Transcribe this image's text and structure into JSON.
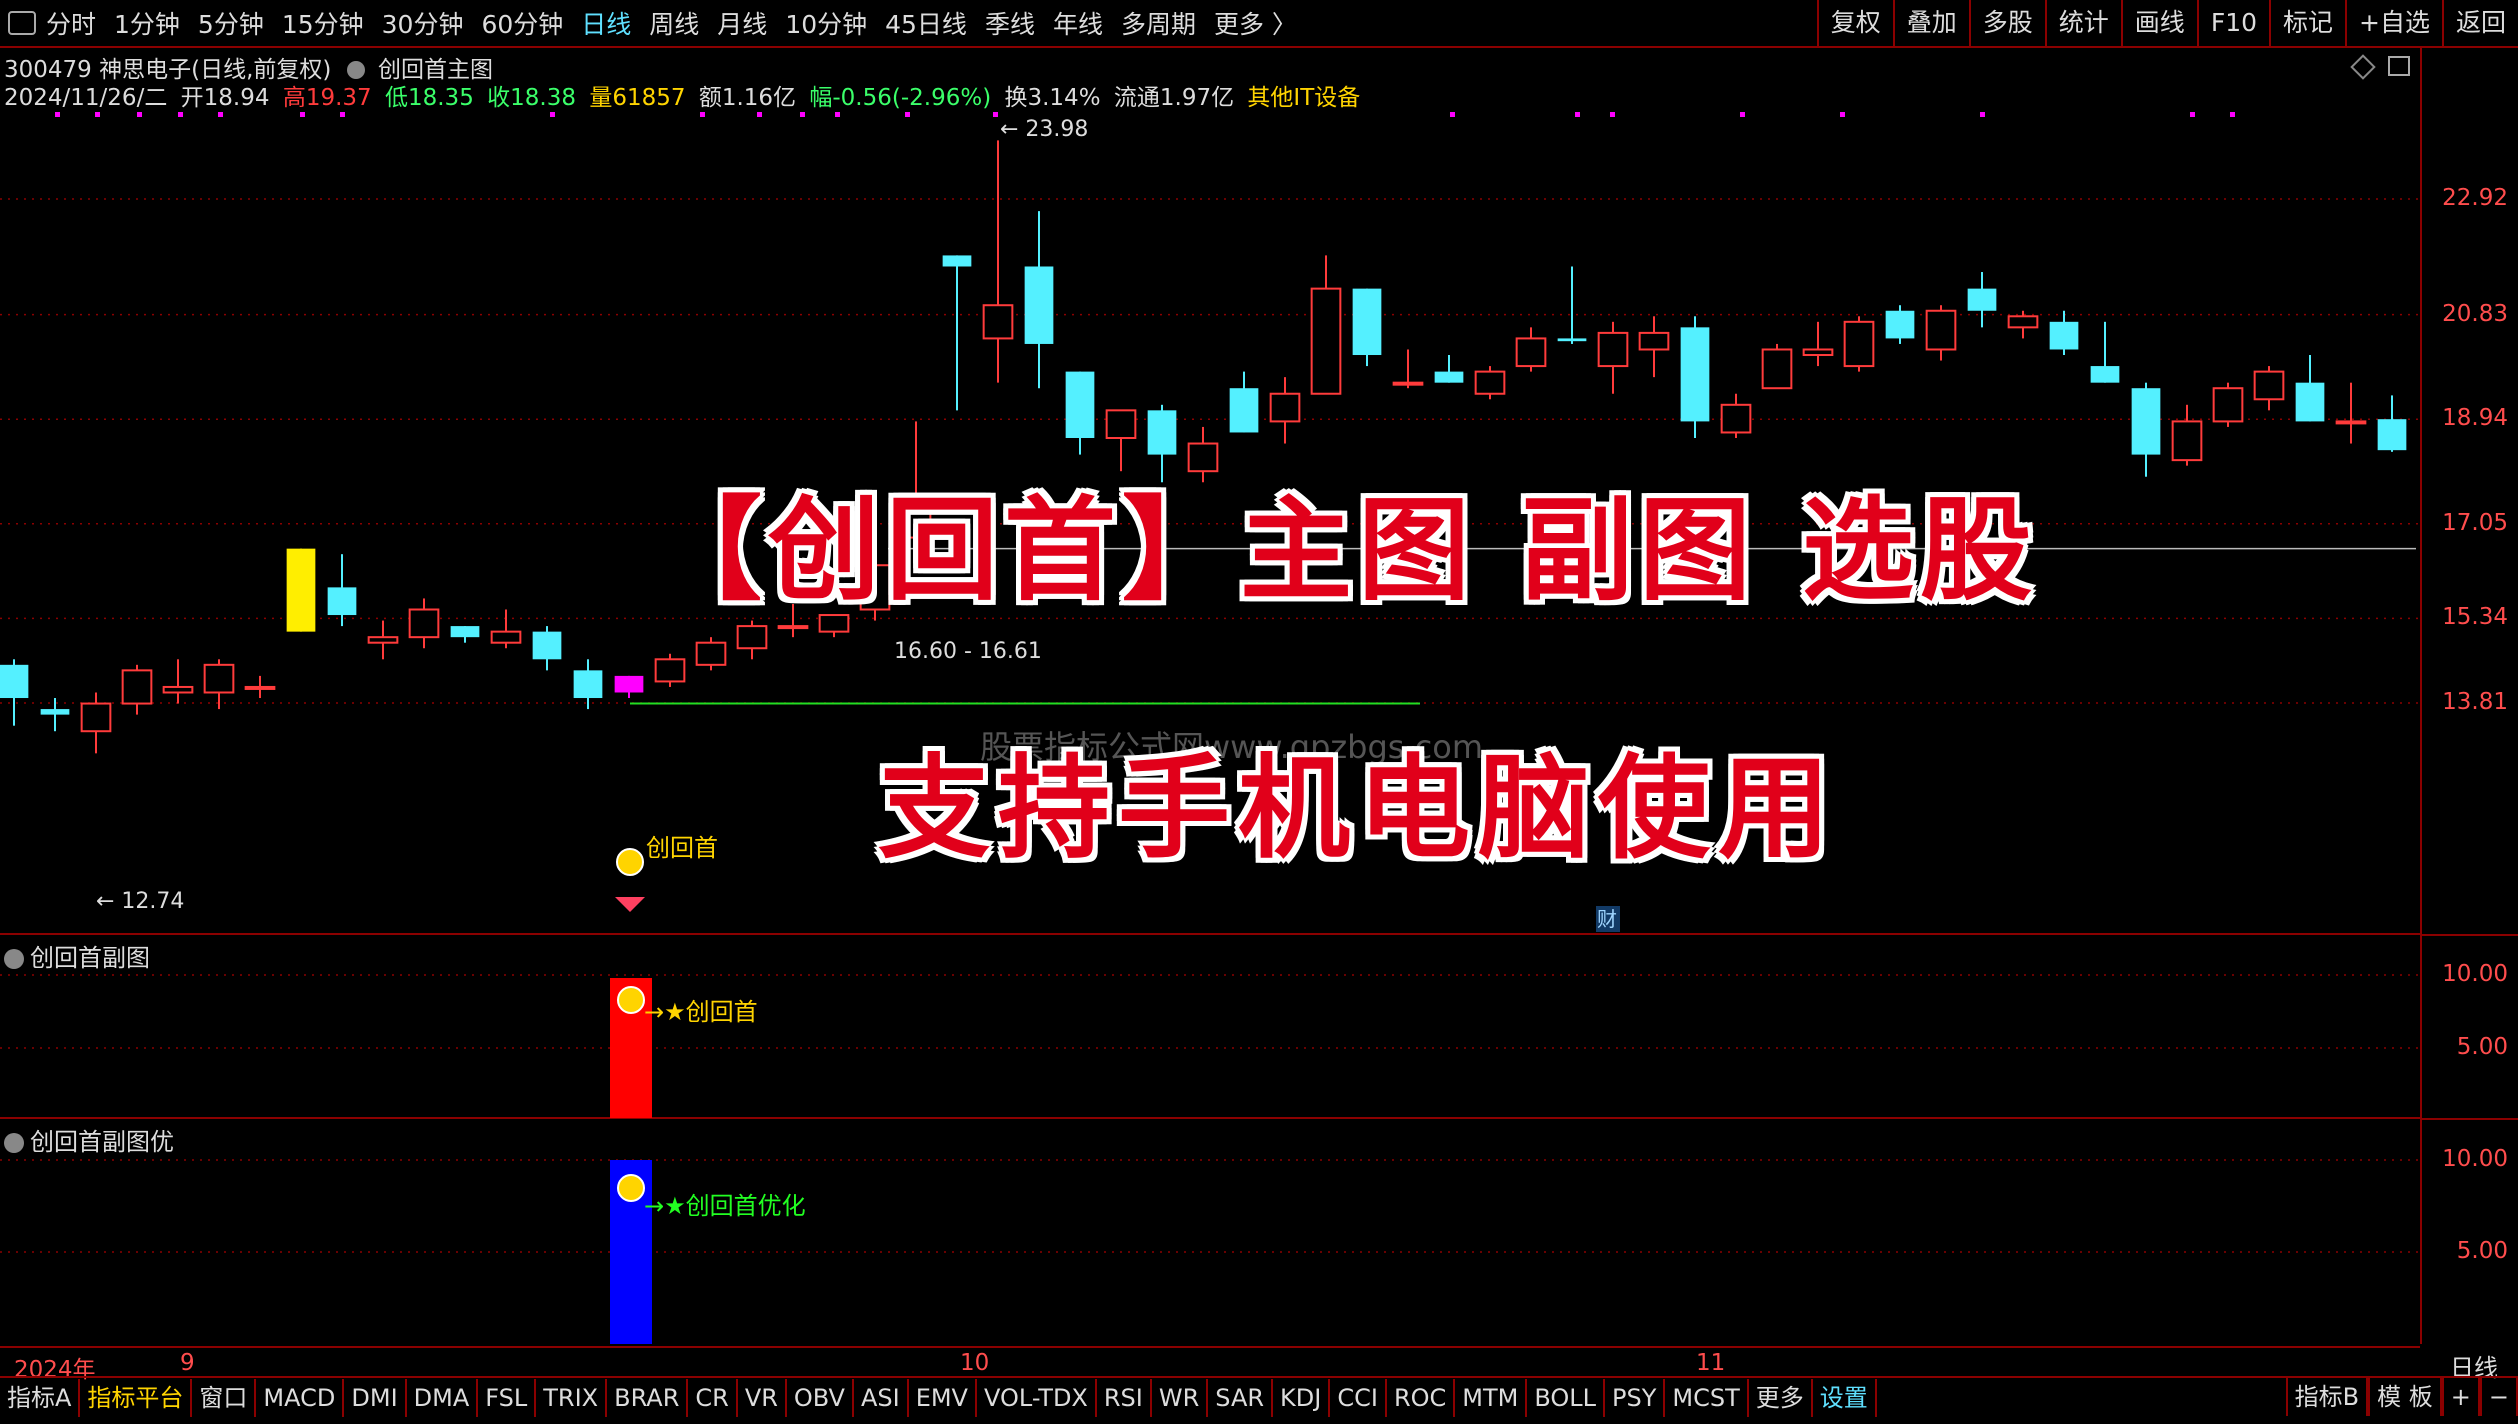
{
  "topbar": {
    "periods": [
      "分时",
      "1分钟",
      "5分钟",
      "15分钟",
      "30分钟",
      "60分钟",
      "日线",
      "周线",
      "月线",
      "10分钟",
      "45日线",
      "季线",
      "年线",
      "多周期",
      "更多 〉"
    ],
    "active_period": "日线",
    "right_buttons": [
      "复权",
      "叠加",
      "多股",
      "统计",
      "画线",
      "F10",
      "标记",
      "+自选",
      "返回"
    ]
  },
  "stock": {
    "title": "300479 神思电子(日线,前复权)",
    "indicator": "创回首主图",
    "date": "2024/11/26/二",
    "open": "开18.94",
    "high": "高19.37",
    "low": "低18.35",
    "close": "收18.38",
    "volume": "量61857",
    "amount": "额1.16亿",
    "change": "幅-0.56(-2.96%)",
    "turnover": "换3.14%",
    "float_cap": "流通1.97亿",
    "sector": "其他IT设备"
  },
  "colors": {
    "up": "#ff3b3b",
    "down": "#54f0ff",
    "grid": "#8b0000",
    "axis_label": "#ff4d4d",
    "signal": "#ff00ff",
    "yellow_bar": "#ffee00"
  },
  "chart_data": {
    "type": "candlestick",
    "y_ticks": [
      22.92,
      20.83,
      18.94,
      17.05,
      15.34,
      13.81
    ],
    "candles": [
      {
        "o": 14.5,
        "h": 14.6,
        "l": 13.4,
        "c": 13.9
      },
      {
        "o": 13.7,
        "h": 13.9,
        "l": 13.3,
        "c": 13.6
      },
      {
        "o": 13.3,
        "h": 14.0,
        "l": 12.9,
        "c": 13.8
      },
      {
        "o": 13.8,
        "h": 14.5,
        "l": 13.6,
        "c": 14.4
      },
      {
        "o": 14.0,
        "h": 14.6,
        "l": 13.8,
        "c": 14.1
      },
      {
        "o": 14.0,
        "h": 14.6,
        "l": 13.7,
        "c": 14.5
      },
      {
        "o": 14.1,
        "h": 14.3,
        "l": 13.9,
        "c": 14.1
      },
      {
        "o": 15.1,
        "h": 16.6,
        "l": 15.1,
        "c": 16.6,
        "color": "yellow"
      },
      {
        "o": 15.9,
        "h": 16.5,
        "l": 15.2,
        "c": 15.4
      },
      {
        "o": 14.9,
        "h": 15.3,
        "l": 14.6,
        "c": 15.0
      },
      {
        "o": 15.0,
        "h": 15.7,
        "l": 14.8,
        "c": 15.5
      },
      {
        "o": 15.2,
        "h": 15.2,
        "l": 14.9,
        "c": 15.0
      },
      {
        "o": 14.9,
        "h": 15.5,
        "l": 14.8,
        "c": 15.1
      },
      {
        "o": 15.1,
        "h": 15.2,
        "l": 14.4,
        "c": 14.6
      },
      {
        "o": 14.4,
        "h": 14.6,
        "l": 13.7,
        "c": 13.9
      },
      {
        "o": 14.0,
        "h": 14.3,
        "l": 13.9,
        "c": 14.3,
        "color": "magenta"
      },
      {
        "o": 14.2,
        "h": 14.7,
        "l": 14.1,
        "c": 14.6
      },
      {
        "o": 14.5,
        "h": 15.0,
        "l": 14.4,
        "c": 14.9
      },
      {
        "o": 14.8,
        "h": 15.3,
        "l": 14.6,
        "c": 15.2
      },
      {
        "o": 15.2,
        "h": 15.6,
        "l": 15.0,
        "c": 15.2
      },
      {
        "o": 15.1,
        "h": 15.4,
        "l": 15.0,
        "c": 15.4
      },
      {
        "o": 15.5,
        "h": 16.6,
        "l": 15.3,
        "c": 16.3
      },
      {
        "o": 16.8,
        "h": 18.9,
        "l": 16.8,
        "c": 17.4
      },
      {
        "o": 21.9,
        "h": 21.9,
        "l": 19.1,
        "c": 21.7
      },
      {
        "o": 20.4,
        "h": 23.98,
        "l": 19.6,
        "c": 21.0
      },
      {
        "o": 21.7,
        "h": 22.7,
        "l": 19.5,
        "c": 20.3
      },
      {
        "o": 19.8,
        "h": 19.8,
        "l": 18.3,
        "c": 18.6
      },
      {
        "o": 18.6,
        "h": 19.1,
        "l": 18.0,
        "c": 19.1
      },
      {
        "o": 19.1,
        "h": 19.2,
        "l": 17.8,
        "c": 18.3
      },
      {
        "o": 18.0,
        "h": 18.8,
        "l": 17.8,
        "c": 18.5
      },
      {
        "o": 19.5,
        "h": 19.8,
        "l": 18.7,
        "c": 18.7
      },
      {
        "o": 18.9,
        "h": 19.7,
        "l": 18.5,
        "c": 19.4
      },
      {
        "o": 19.4,
        "h": 21.9,
        "l": 19.4,
        "c": 21.3
      },
      {
        "o": 21.3,
        "h": 21.3,
        "l": 19.9,
        "c": 20.1
      },
      {
        "o": 19.6,
        "h": 20.2,
        "l": 19.5,
        "c": 19.6
      },
      {
        "o": 19.8,
        "h": 20.1,
        "l": 19.6,
        "c": 19.6
      },
      {
        "o": 19.4,
        "h": 19.9,
        "l": 19.3,
        "c": 19.8
      },
      {
        "o": 19.9,
        "h": 20.6,
        "l": 19.8,
        "c": 20.4
      },
      {
        "o": 20.4,
        "h": 21.7,
        "l": 20.3,
        "c": 20.35
      },
      {
        "o": 19.9,
        "h": 20.7,
        "l": 19.4,
        "c": 20.5
      },
      {
        "o": 20.2,
        "h": 20.8,
        "l": 19.7,
        "c": 20.5
      },
      {
        "o": 20.6,
        "h": 20.8,
        "l": 18.6,
        "c": 18.9
      },
      {
        "o": 18.7,
        "h": 19.4,
        "l": 18.6,
        "c": 19.2
      },
      {
        "o": 19.5,
        "h": 20.3,
        "l": 19.5,
        "c": 20.2
      },
      {
        "o": 20.1,
        "h": 20.7,
        "l": 19.9,
        "c": 20.2
      },
      {
        "o": 19.9,
        "h": 20.8,
        "l": 19.8,
        "c": 20.7
      },
      {
        "o": 20.9,
        "h": 21.0,
        "l": 20.3,
        "c": 20.4
      },
      {
        "o": 20.2,
        "h": 21.0,
        "l": 20.0,
        "c": 20.9
      },
      {
        "o": 21.3,
        "h": 21.6,
        "l": 20.6,
        "c": 20.9
      },
      {
        "o": 20.6,
        "h": 20.9,
        "l": 20.4,
        "c": 20.8
      },
      {
        "o": 20.7,
        "h": 20.9,
        "l": 20.1,
        "c": 20.2
      },
      {
        "o": 19.9,
        "h": 20.7,
        "l": 19.6,
        "c": 19.6
      },
      {
        "o": 19.5,
        "h": 19.6,
        "l": 17.9,
        "c": 18.3
      },
      {
        "o": 18.2,
        "h": 19.2,
        "l": 18.1,
        "c": 18.9
      },
      {
        "o": 18.9,
        "h": 19.6,
        "l": 18.8,
        "c": 19.5
      },
      {
        "o": 19.3,
        "h": 19.9,
        "l": 19.1,
        "c": 19.8
      },
      {
        "o": 19.6,
        "h": 20.1,
        "l": 18.9,
        "c": 18.9
      },
      {
        "o": 18.9,
        "h": 19.6,
        "l": 18.5,
        "c": 18.9
      },
      {
        "o": 18.94,
        "h": 19.37,
        "l": 18.35,
        "c": 18.38
      }
    ],
    "annotations": {
      "high_label": "23.98",
      "low_label": "12.74",
      "range_label": "16.60 - 16.61",
      "signal_label": "创回首",
      "fin_label": "财"
    }
  },
  "subchart1": {
    "title": "创回首副图",
    "ticks": [
      "10.00",
      "5.00"
    ],
    "signal": "★创回首",
    "bar_value": 10
  },
  "subchart2": {
    "title": "创回首副图优",
    "ticks": [
      "10.00",
      "5.00"
    ],
    "signal": "★创回首优化",
    "bar_value": 10
  },
  "dates": {
    "year": "2024年",
    "m9": "9",
    "m10": "10",
    "m11": "11",
    "period": "日线"
  },
  "overlay": {
    "line1": "【创回首】主图 副图 选股",
    "line2": "支持手机电脑使用",
    "watermark": "股票指标公式网www.gpzbgs.com"
  },
  "bottombar": {
    "tabs": [
      "指标A",
      "指标平台",
      "窗口",
      "MACD",
      "DMI",
      "DMA",
      "FSL",
      "TRIX",
      "BRAR",
      "CR",
      "VR",
      "OBV",
      "ASI",
      "EMV",
      "VOL-TDX",
      "RSI",
      "WR",
      "SAR",
      "KDJ",
      "CCI",
      "ROC",
      "MTM",
      "BOLL",
      "PSY",
      "MCST",
      "更多",
      "设置"
    ],
    "right_tabs": [
      "指标B",
      "模 板",
      "+",
      "−"
    ]
  }
}
